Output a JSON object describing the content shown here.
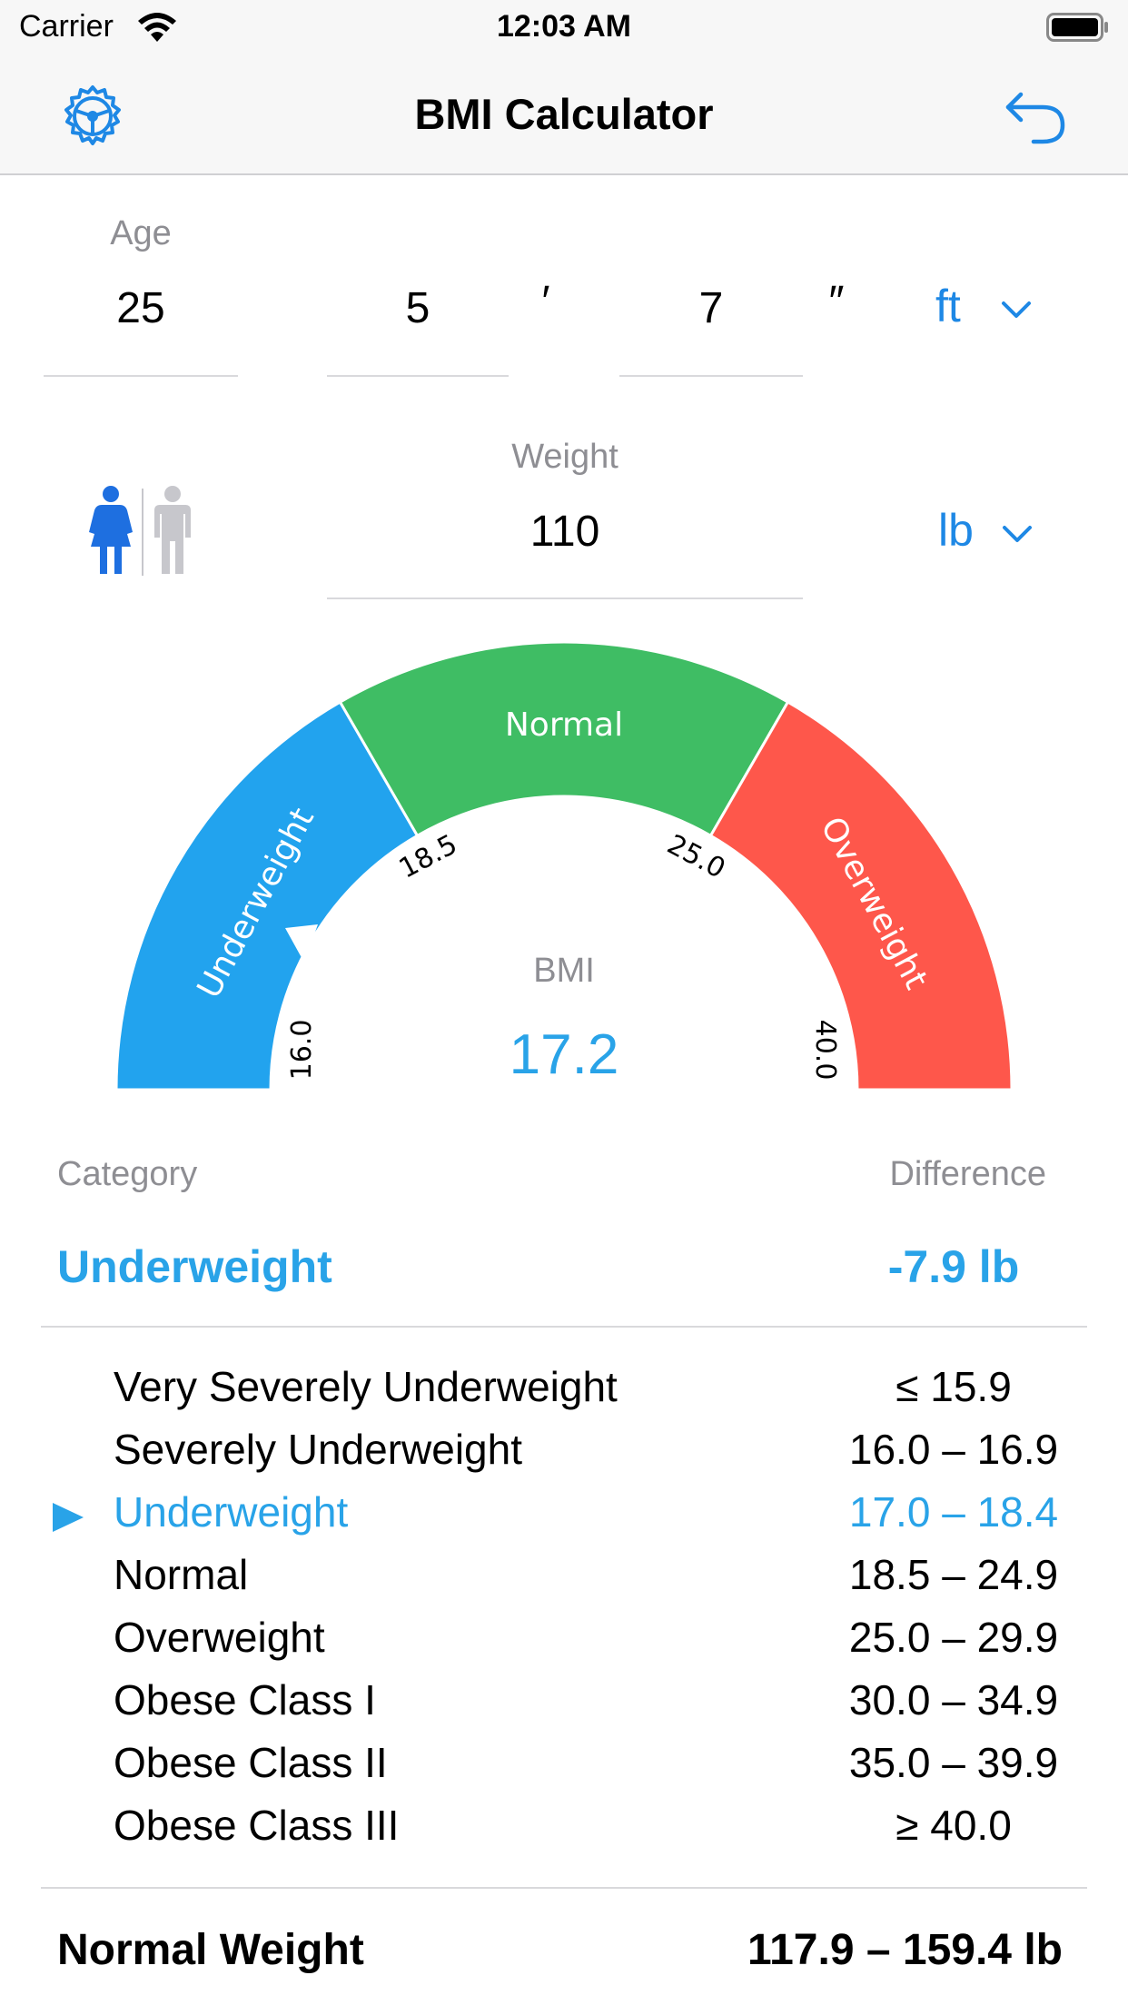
{
  "status_bar": {
    "carrier": "Carrier",
    "time": "12:03 AM"
  },
  "nav": {
    "title": "BMI Calculator"
  },
  "inputs": {
    "age_label": "Age",
    "age_value": "25",
    "height_feet": "5",
    "feet_mark": "′",
    "height_inches": "7",
    "inch_mark": "″",
    "height_unit": "ft",
    "weight_label": "Weight",
    "weight_value": "110",
    "weight_unit": "lb",
    "selected_gender": "female"
  },
  "gauge": {
    "bmi_label": "BMI",
    "bmi_value": "17.2",
    "segments": [
      {
        "label": "Underweight",
        "color": "#22a3ee"
      },
      {
        "label": "Normal",
        "color": "#3fbd64"
      },
      {
        "label": "Overweight",
        "color": "#fe574b"
      }
    ],
    "ticks": [
      "16.0",
      "18.5",
      "25.0",
      "40.0"
    ]
  },
  "result": {
    "category_header": "Category",
    "difference_header": "Difference",
    "category_value": "Underweight",
    "difference_value": "-7.9 lb"
  },
  "table": {
    "rows": [
      {
        "label": "Very Severely Underweight",
        "range": "≤ 15.9",
        "active": false
      },
      {
        "label": "Severely Underweight",
        "range": "16.0 – 16.9",
        "active": false
      },
      {
        "label": "Underweight",
        "range": "17.0 – 18.4",
        "active": true
      },
      {
        "label": "Normal",
        "range": "18.5 – 24.9",
        "active": false
      },
      {
        "label": "Overweight",
        "range": "25.0 – 29.9",
        "active": false
      },
      {
        "label": "Obese Class I",
        "range": "30.0 – 34.9",
        "active": false
      },
      {
        "label": "Obese Class II",
        "range": "35.0 – 39.9",
        "active": false
      },
      {
        "label": "Obese Class III",
        "range": "≥ 40.0",
        "active": false
      }
    ]
  },
  "footer": {
    "label": "Normal Weight",
    "value": "117.9 – 159.4 lb"
  },
  "colors": {
    "accent": "#1e88e5",
    "result_blue": "#29a3e8"
  }
}
